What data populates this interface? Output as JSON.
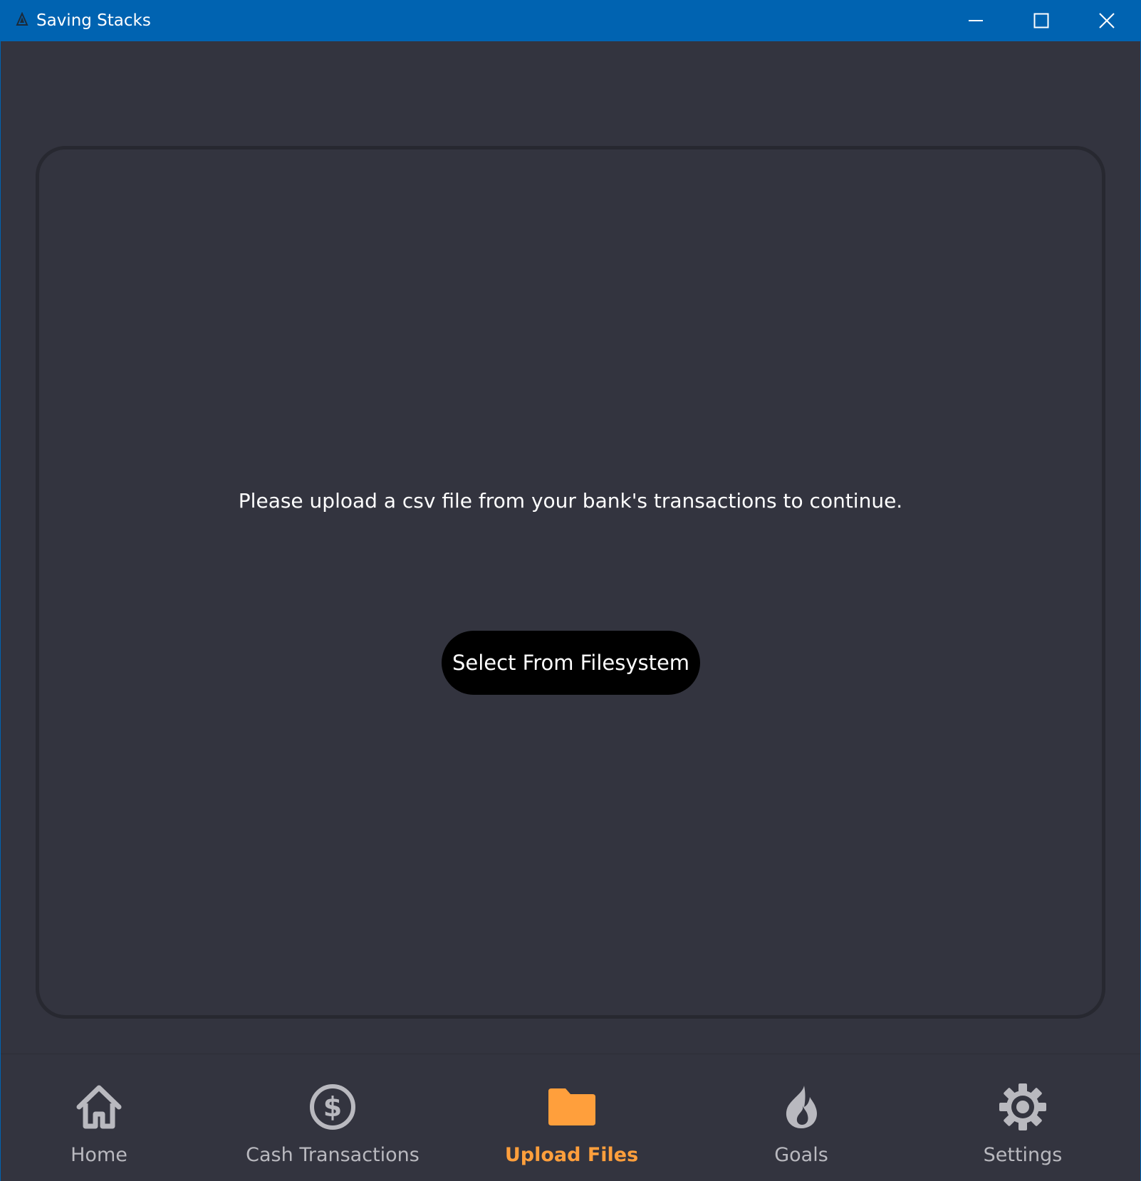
{
  "window": {
    "title": "Saving Stacks",
    "icon": "app-logo-icon",
    "controls": [
      "minimize-icon",
      "maximize-icon",
      "close-icon"
    ],
    "titlebar_color": "#0063b1"
  },
  "main": {
    "prompt": "Please upload a csv file from your bank's transactions to continue.",
    "select_button_label": "Select From Filesystem"
  },
  "nav": {
    "active_color": "#ff9f3c",
    "inactive_color": "#b9b9bf",
    "items": [
      {
        "label": "Home",
        "icon": "home-icon",
        "active": false
      },
      {
        "label": "Cash Transactions",
        "icon": "dollar-icon",
        "active": false
      },
      {
        "label": "Upload Files",
        "icon": "folder-icon",
        "active": true
      },
      {
        "label": "Goals",
        "icon": "flame-icon",
        "active": false
      },
      {
        "label": "Settings",
        "icon": "gear-icon",
        "active": false
      }
    ]
  }
}
